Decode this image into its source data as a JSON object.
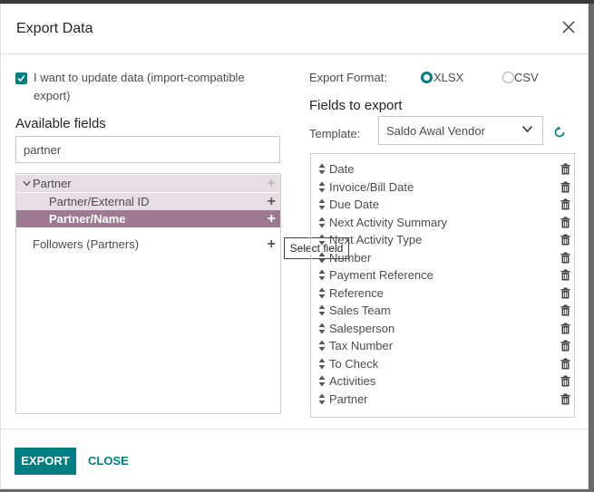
{
  "dialog": {
    "title": "Export Data",
    "import_compatible_label": "I want to update data (import-compatible export)",
    "import_compatible_checked": true
  },
  "available": {
    "title": "Available fields",
    "search_value": "partner",
    "tree": {
      "parent": "Partner",
      "children": [
        "Partner/External ID",
        "Partner/Name"
      ],
      "other": "Followers (Partners)"
    },
    "tooltip": "Select field"
  },
  "export_format": {
    "label": "Export Format:",
    "options": [
      "XLSX",
      "CSV"
    ],
    "selected": "XLSX"
  },
  "fields_to_export": {
    "title": "Fields to export",
    "template_label": "Template:",
    "template_value": "Saldo Awal Vendor",
    "items": [
      "Date",
      "Invoice/Bill Date",
      "Due Date",
      "Next Activity Summary",
      "Next Activity Type",
      "Number",
      "Payment Reference",
      "Reference",
      "Sales Team",
      "Salesperson",
      "Tax Number",
      "To Check",
      "Activities",
      "Partner"
    ]
  },
  "footer": {
    "export_label": "EXPORT",
    "close_label": "CLOSE"
  },
  "colors": {
    "accent": "#017e84",
    "highlight": "#9d7a92",
    "tree_bg": "#e7dde4"
  }
}
